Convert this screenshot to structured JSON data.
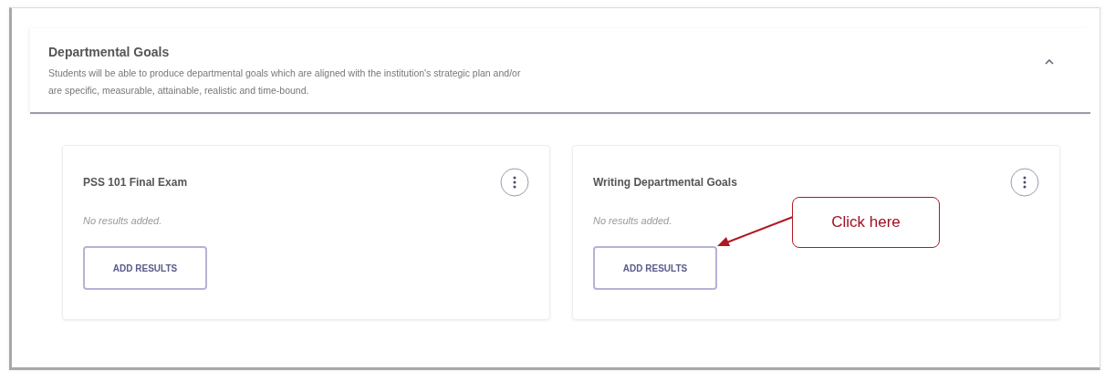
{
  "section": {
    "title": "Departmental Goals",
    "description": "Students will be able to produce departmental goals which are aligned with the institution's strategic plan and/or are specific, measurable, attainable, realistic and time-bound.",
    "expanded": true
  },
  "cards": [
    {
      "title": "PSS 101 Final Exam",
      "status": "No results added.",
      "button": "ADD RESULTS"
    },
    {
      "title": "Writing Departmental Goals",
      "status": "No results added.",
      "button": "ADD RESULTS"
    }
  ],
  "callout": {
    "text": "Click here"
  }
}
